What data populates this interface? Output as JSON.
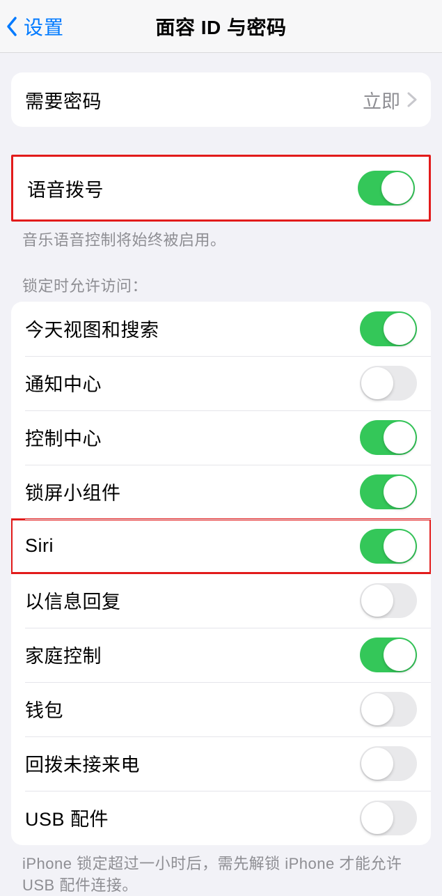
{
  "header": {
    "back_label": "设置",
    "title": "面容 ID 与密码"
  },
  "passcode_group": {
    "require_passcode": {
      "label": "需要密码",
      "value": "立即"
    }
  },
  "voice_group": {
    "voice_dial": {
      "label": "语音拨号",
      "on": true
    },
    "footer": "音乐语音控制将始终被启用。"
  },
  "lock_access": {
    "header": "锁定时允许访问：",
    "items": [
      {
        "label": "今天视图和搜索",
        "on": true,
        "highlight": false
      },
      {
        "label": "通知中心",
        "on": false,
        "highlight": false
      },
      {
        "label": "控制中心",
        "on": true,
        "highlight": false
      },
      {
        "label": "锁屏小组件",
        "on": true,
        "highlight": false
      },
      {
        "label": "Siri",
        "on": true,
        "highlight": true
      },
      {
        "label": "以信息回复",
        "on": false,
        "highlight": false
      },
      {
        "label": "家庭控制",
        "on": true,
        "highlight": false
      },
      {
        "label": "钱包",
        "on": false,
        "highlight": false
      },
      {
        "label": "回拨未接来电",
        "on": false,
        "highlight": false
      },
      {
        "label": "USB 配件",
        "on": false,
        "highlight": false
      }
    ],
    "footer": "iPhone 锁定超过一小时后，需先解锁 iPhone 才能允许USB 配件连接。"
  }
}
